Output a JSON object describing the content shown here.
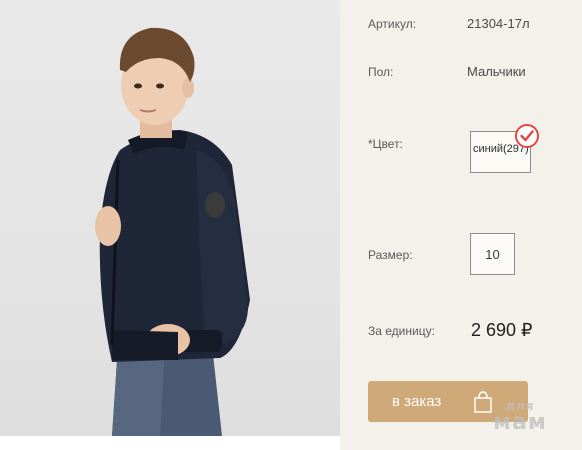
{
  "product": {
    "article_label": "Артикул:",
    "article_value": "21304-17л",
    "gender_label": "Пол:",
    "gender_value": "Мальчики",
    "color_label": "*Цвет:",
    "color_option": "синий(297)",
    "size_label": "Размер:",
    "size_value": "10",
    "price_label": "За единицу:",
    "price_value": "2 690 ₽"
  },
  "order_button": {
    "label": "в заказ",
    "icon": "shopping-bag-icon"
  },
  "color_check_icon": "check-icon",
  "watermark": {
    "line1": "для",
    "line2": "мам"
  },
  "colors": {
    "panel_bg": "#f4f1ea",
    "button_bg": "#cfaa78",
    "check_color": "#e2473f",
    "jacket": "#1f2637"
  }
}
